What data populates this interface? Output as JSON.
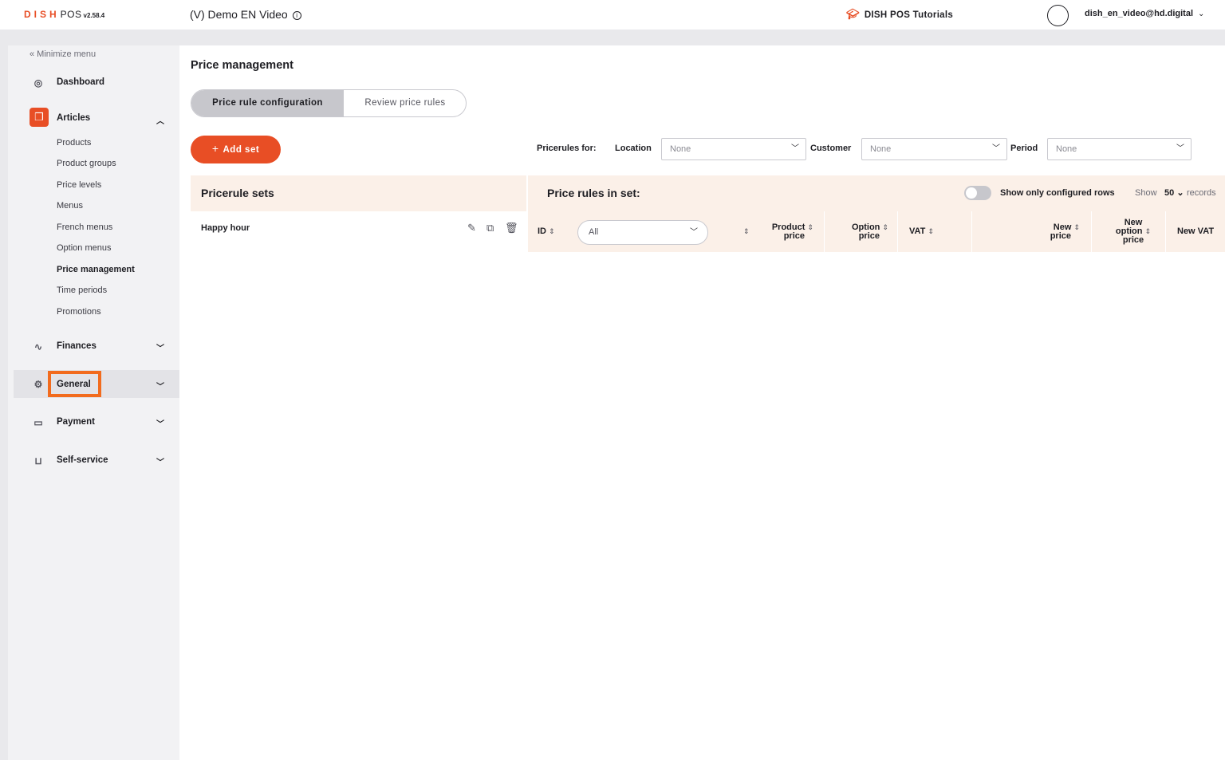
{
  "topbar": {
    "brand_dish": "DISH",
    "brand_pos": "POS",
    "version": "v2.58.4",
    "venue": "(V) Demo EN Video",
    "tutorials": "DISH POS Tutorials",
    "user_email": "dish_en_video@hd.digital"
  },
  "sidebar": {
    "minimize": "« Minimize menu",
    "dashboard": "Dashboard",
    "articles": "Articles",
    "article_items": [
      "Products",
      "Product groups",
      "Price levels",
      "Menus",
      "French menus",
      "Option menus",
      "Price management",
      "Time periods",
      "Promotions"
    ],
    "finances": "Finances",
    "general": "General",
    "payment": "Payment",
    "self_service": "Self-service"
  },
  "main": {
    "title": "Price management",
    "tab_config": "Price rule configuration",
    "tab_review": "Review price rules",
    "add_set": "Add set",
    "filters": {
      "pricerules_for": "Pricerules for:",
      "location_label": "Location",
      "location_value": "None",
      "customer_label": "Customer",
      "customer_value": "None",
      "period_label": "Period",
      "period_value": "None"
    },
    "sets_title": "Pricerule sets",
    "rules_title": "Price rules in set:",
    "show_configured": "Show only configured rows",
    "show_label": "Show",
    "records_count": "50",
    "records_label": "records",
    "sets": [
      {
        "name": "Happy hour"
      }
    ],
    "columns": {
      "id": "ID",
      "filter_value": "All",
      "product_price_1": "Product",
      "product_price_2": "price",
      "option_price_1": "Option",
      "option_price_2": "price",
      "vat": "VAT",
      "new_price_1": "New",
      "new_price_2": "price",
      "new_option_1": "New",
      "new_option_2": "option",
      "new_option_3": "price",
      "new_vat": "New VAT"
    }
  },
  "colors": {
    "accent": "#e84e25",
    "highlight": "#f26b1d",
    "header_bg": "#fbf0e8"
  }
}
